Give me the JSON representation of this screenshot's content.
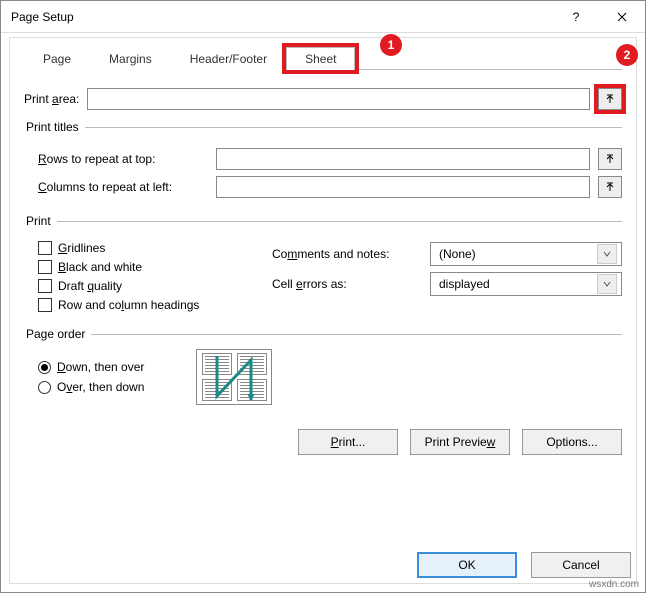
{
  "window": {
    "title": "Page Setup"
  },
  "tabs": {
    "page": "Page",
    "margins": "Margins",
    "header": "Header/Footer",
    "sheet": "Sheet"
  },
  "callouts": {
    "one": "1",
    "two": "2"
  },
  "labels": {
    "print_area": "Print area:",
    "print_titles": "Print titles",
    "rows_repeat": "Rows to repeat at top:",
    "cols_repeat": "Columns to repeat at left:",
    "print": "Print",
    "gridlines": "Gridlines",
    "bw": "Black and white",
    "draft": "Draft quality",
    "rowcol": "Row and column headings",
    "comments": "Comments and notes:",
    "cellerr": "Cell errors as:",
    "comments_val": "(None)",
    "cellerr_val": "displayed",
    "page_order": "Page order",
    "down": "Down, then over",
    "over": "Over, then down"
  },
  "buttons": {
    "print": "Print...",
    "preview": "Print Preview",
    "options": "Options...",
    "ok": "OK",
    "cancel": "Cancel"
  },
  "watermark": "wsxdn.com"
}
